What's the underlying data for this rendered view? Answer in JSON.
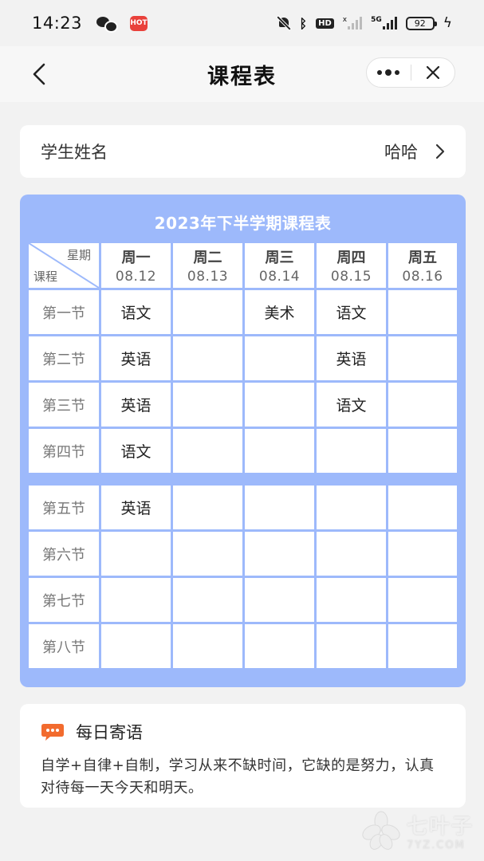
{
  "status_bar": {
    "time": "14:23",
    "app_badge": "HOT",
    "hd_label": "HD",
    "signal_label_1": "x",
    "signal_label_2": "5G",
    "battery": "92"
  },
  "nav": {
    "title": "课程表"
  },
  "student": {
    "label": "学生姓名",
    "value": "哈哈"
  },
  "schedule": {
    "title": "2023年下半学期课程表",
    "corner_top": "星期",
    "corner_bottom": "课程",
    "days": [
      {
        "day": "周一",
        "date": "08.12"
      },
      {
        "day": "周二",
        "date": "08.13"
      },
      {
        "day": "周三",
        "date": "08.14"
      },
      {
        "day": "周四",
        "date": "08.15"
      },
      {
        "day": "周五",
        "date": "08.16"
      }
    ],
    "periods": [
      "第一节",
      "第二节",
      "第三节",
      "第四节",
      "第五节",
      "第六节",
      "第七节",
      "第八节"
    ],
    "courses": [
      [
        "语文",
        "",
        "美术",
        "语文",
        ""
      ],
      [
        "英语",
        "",
        "",
        "英语",
        ""
      ],
      [
        "英语",
        "",
        "",
        "语文",
        ""
      ],
      [
        "语文",
        "",
        "",
        "",
        ""
      ],
      [
        "英语",
        "",
        "",
        "",
        ""
      ],
      [
        "",
        "",
        "",
        "",
        ""
      ],
      [
        "",
        "",
        "",
        "",
        ""
      ],
      [
        "",
        "",
        "",
        "",
        ""
      ]
    ]
  },
  "quote": {
    "title": "每日寄语",
    "text": "自学+自律+自制，学习从来不缺时间，它缺的是努力，认真对待每一天今天和明天。"
  },
  "watermark": {
    "name": "七叶子",
    "url": "7YZ.COM"
  },
  "colors": {
    "schedule_bg": "#9db9fb",
    "quote_icon": "#f26b2e"
  }
}
